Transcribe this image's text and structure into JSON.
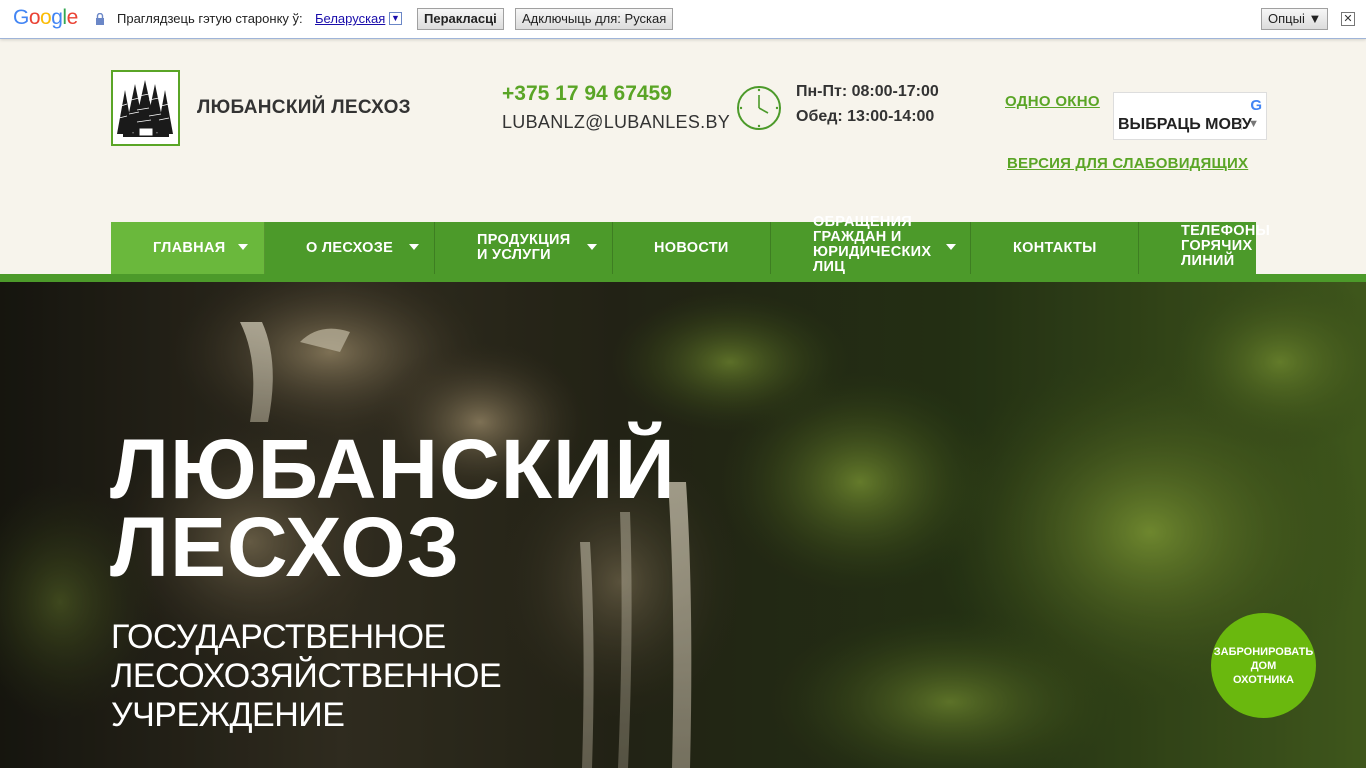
{
  "translate_bar": {
    "logo": "Google",
    "prompt": "Праглядзець гэтую старонку ў:",
    "language": "Беларуская",
    "translate_button": "Перакласці",
    "turn_off_button": "Адключыць для: Руская",
    "options_button": "Опцыі ▼",
    "close": "✕"
  },
  "header": {
    "site_name": "ЛЮБАНСКИЙ ЛЕСХОЗ",
    "phone": "+375 17 94 67459",
    "email": "LUBANLZ@LUBANLES.BY",
    "hours_weekdays": "Пн-Пт: 08:00-17:00",
    "hours_lunch": "Обед: 13:00-14:00",
    "one_window": "ОДНО ОКНО",
    "language_select": "ВЫБРАЦЬ МОВУ",
    "low_vision": "ВЕРСИЯ ДЛЯ СЛАБОВИДЯЩИХ"
  },
  "nav": {
    "items": [
      {
        "label": "ГЛАВНАЯ"
      },
      {
        "label": "О ЛЕСХОЗЕ"
      },
      {
        "label": "ПРОДУКЦИЯ\nИ УСЛУГИ"
      },
      {
        "label": "НОВОСТИ"
      },
      {
        "label": "ОБРАЩЕНИЯ\nГРАЖДАН И\nЮРИДИЧЕСКИХ\nЛИЦ"
      },
      {
        "label": "КОНТАКТЫ"
      },
      {
        "label": "ТЕЛЕФОНЫ\nГОРЯЧИХ\nЛИНИЙ"
      }
    ]
  },
  "hero": {
    "title_line1": "ЛЮБАНСКИЙ",
    "title_line2": "ЛЕСХОЗ",
    "subtitle_line1": "ГОСУДАРСТВЕННОЕ",
    "subtitle_line2": "ЛЕСОХОЗЯЙСТВЕННОЕ",
    "subtitle_line3": "УЧРЕЖДЕНИЕ"
  },
  "book_button": "ЗАБРОНИРОВАТЬ\nДОМ\nОХОТНИКА",
  "colors": {
    "brand_green": "#4c9a2a",
    "active_green": "#6ab83c",
    "text_green": "#5aa526",
    "background": "#f7f4ec"
  }
}
